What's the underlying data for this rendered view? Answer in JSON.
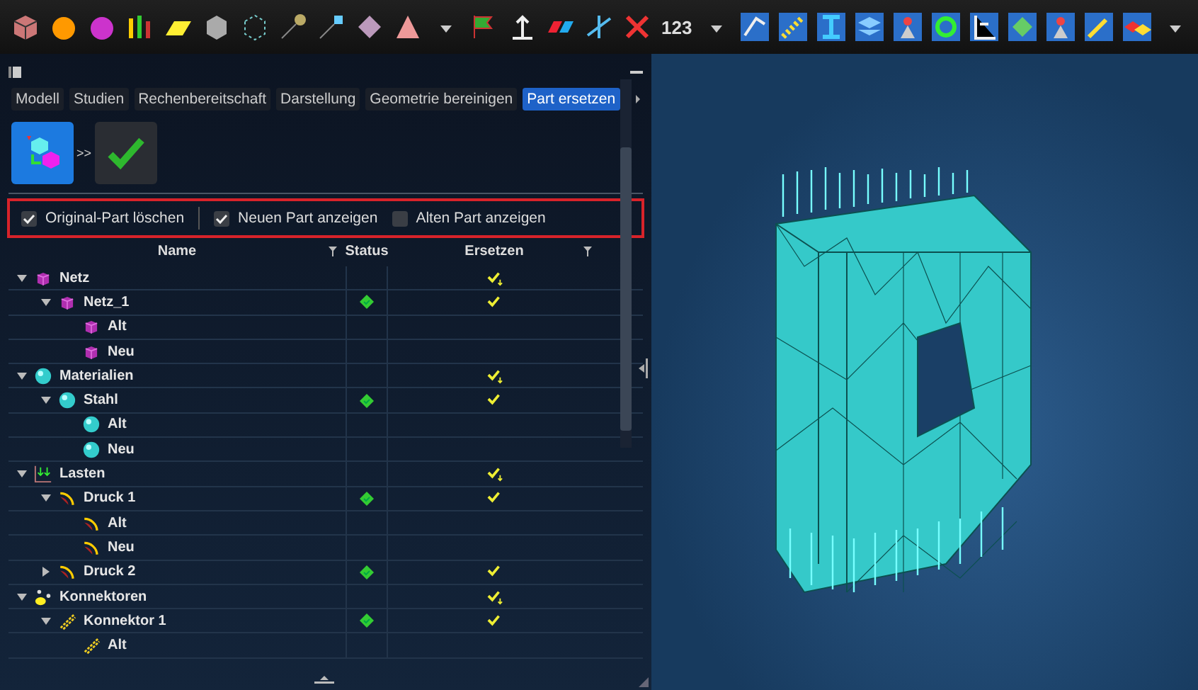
{
  "toolbar": {
    "number_label": "123"
  },
  "panel": {
    "tabs": [
      {
        "label": "Modell",
        "selected": false
      },
      {
        "label": "Studien",
        "selected": false
      },
      {
        "label": "Rechenbereitschaft",
        "selected": false
      },
      {
        "label": "Darstellung",
        "selected": false
      },
      {
        "label": "Geometrie bereinigen",
        "selected": false
      },
      {
        "label": "Part ersetzen",
        "selected": true
      }
    ],
    "step_separator": ">>",
    "options": [
      {
        "label": "Original-Part löschen",
        "checked": true
      },
      {
        "label": "Neuen Part anzeigen",
        "checked": true
      },
      {
        "label": "Alten Part anzeigen",
        "checked": false
      }
    ],
    "table": {
      "columns": [
        "Name",
        "Status",
        "Ersetzen"
      ],
      "rows": [
        {
          "label": "Netz",
          "kind": "mesh",
          "expanded": true,
          "status_ok": false,
          "replace": true,
          "cascade": true,
          "children": [
            {
              "label": "Netz_1",
              "kind": "mesh",
              "expanded": true,
              "status_ok": true,
              "replace": true,
              "cascade": false,
              "children": [
                {
                  "label": "Alt",
                  "kind": "mesh",
                  "status_ok": false,
                  "replace": false
                },
                {
                  "label": "Neu",
                  "kind": "mesh",
                  "status_ok": false,
                  "replace": false
                }
              ]
            }
          ]
        },
        {
          "label": "Materialien",
          "kind": "material",
          "expanded": true,
          "status_ok": false,
          "replace": true,
          "cascade": true,
          "children": [
            {
              "label": "Stahl",
              "kind": "material",
              "expanded": true,
              "status_ok": true,
              "replace": true,
              "cascade": false,
              "children": [
                {
                  "label": "Alt",
                  "kind": "material",
                  "status_ok": false,
                  "replace": false
                },
                {
                  "label": "Neu",
                  "kind": "material",
                  "status_ok": false,
                  "replace": false
                }
              ]
            }
          ]
        },
        {
          "label": "Lasten",
          "kind": "loads",
          "expanded": true,
          "status_ok": false,
          "replace": true,
          "cascade": true,
          "children": [
            {
              "label": "Druck 1",
              "kind": "pressure",
              "expanded": true,
              "status_ok": true,
              "replace": true,
              "cascade": false,
              "children": [
                {
                  "label": "Alt",
                  "kind": "pressure",
                  "status_ok": false,
                  "replace": false
                },
                {
                  "label": "Neu",
                  "kind": "pressure",
                  "status_ok": false,
                  "replace": false
                }
              ]
            },
            {
              "label": "Druck 2",
              "kind": "pressure",
              "expanded": false,
              "status_ok": true,
              "replace": true,
              "cascade": false
            }
          ]
        },
        {
          "label": "Konnektoren",
          "kind": "connectors",
          "expanded": true,
          "status_ok": false,
          "replace": true,
          "cascade": true,
          "children": [
            {
              "label": "Konnektor 1",
              "kind": "connector",
              "expanded": true,
              "status_ok": true,
              "replace": true,
              "cascade": false,
              "children": [
                {
                  "label": "Alt",
                  "kind": "connector",
                  "status_ok": false,
                  "replace": false
                }
              ]
            }
          ]
        }
      ]
    }
  }
}
